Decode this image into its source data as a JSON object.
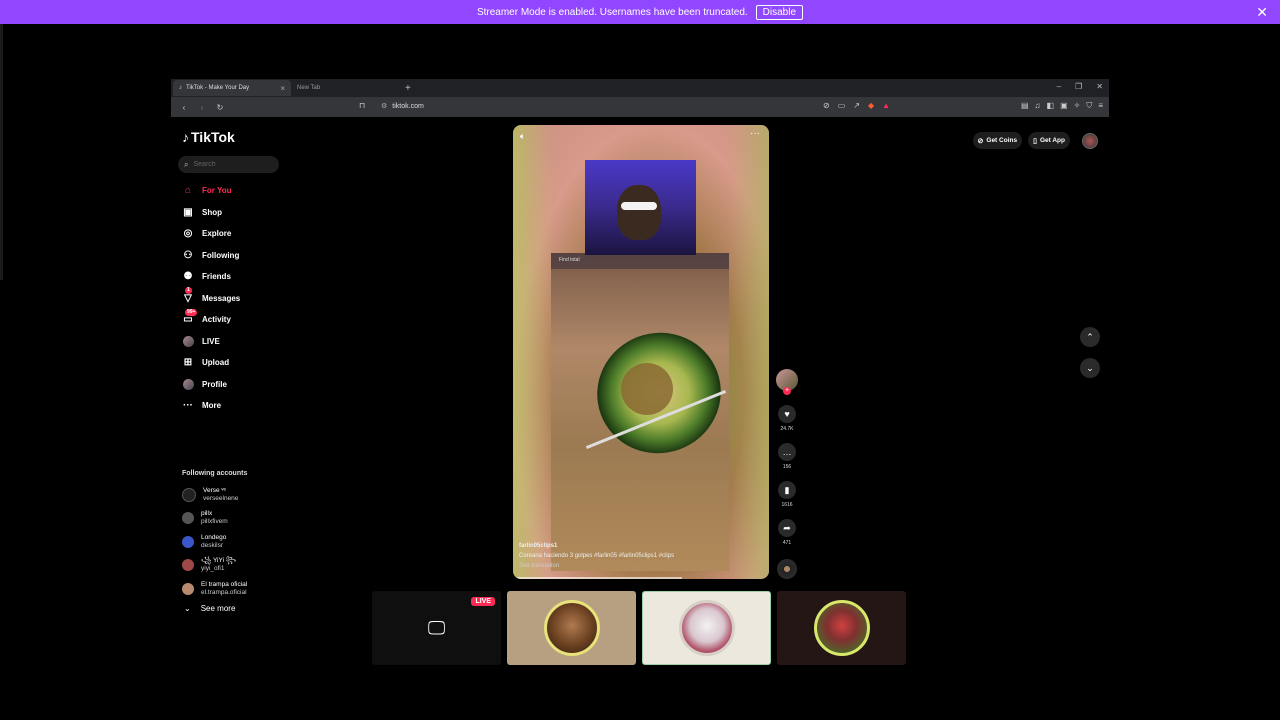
{
  "banner": {
    "message": "Streamer Mode is enabled. Usernames have been truncated.",
    "disable_label": "Disable",
    "close_icon": "✕"
  },
  "browser": {
    "tabs": [
      {
        "title": "TikTok - Make Your Day",
        "active": true
      },
      {
        "title": "New Tab",
        "active": false
      }
    ],
    "url": "tiktok.com"
  },
  "tiktok": {
    "logo_text": "TikTok",
    "search_placeholder": "Search",
    "menu": [
      {
        "label": "For You",
        "icon": "home-icon",
        "active": true
      },
      {
        "label": "Shop",
        "icon": "shop-icon"
      },
      {
        "label": "Explore",
        "icon": "compass-icon"
      },
      {
        "label": "Following",
        "icon": "following-icon"
      },
      {
        "label": "Friends",
        "icon": "friends-icon"
      },
      {
        "label": "Messages",
        "icon": "messages-icon",
        "badge": "1"
      },
      {
        "label": "Activity",
        "icon": "activity-icon",
        "badge": "99+"
      },
      {
        "label": "LIVE",
        "icon": "live-icon"
      },
      {
        "label": "Upload",
        "icon": "upload-icon"
      },
      {
        "label": "Profile",
        "icon": "profile-avatar"
      },
      {
        "label": "More",
        "icon": "more-icon"
      }
    ],
    "following_title": "Following accounts",
    "following": [
      {
        "name": "Verse ᵛᵉ",
        "handle": "verseelnene"
      },
      {
        "name": "pillx",
        "handle": "pillxfivem"
      },
      {
        "name": "Londego",
        "handle": "deskilsr"
      },
      {
        "name": "꧁ YiYi ꧂",
        "handle": "yiyi_ofi1"
      },
      {
        "name": "El trampa oficial",
        "handle": "el.trampa.oficial"
      }
    ],
    "see_more": "See more",
    "top_right": {
      "get_coins": "Get Coins",
      "get_app": "Get App"
    },
    "video": {
      "clip_header": "Find total",
      "author": "farlin05clips1",
      "caption": "Coreana haciendo 3 golpes #farlin05 #farlin05clips1 #clips",
      "see_translation": "See translation",
      "progress": 0.66
    },
    "actions": {
      "likes": "24.7K",
      "comments": "156",
      "saves": "1616",
      "shares": "471"
    },
    "live_badge": "LIVE"
  },
  "colors": {
    "banner": "#9146ff",
    "accent": "#fe2c55"
  }
}
